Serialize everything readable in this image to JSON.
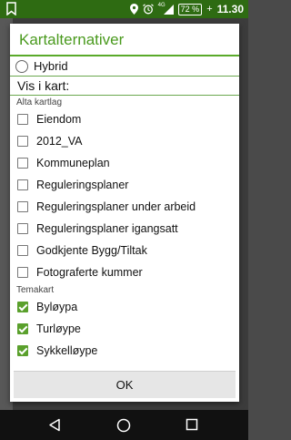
{
  "status_bar": {
    "network": "4G",
    "battery": "72 %",
    "time": "11.30"
  },
  "dialog": {
    "title": "Kartalternativer",
    "radio_option": "Hybrid",
    "vis_i_kart": "Vis i kart:",
    "alta_section": "Alta kartlag",
    "alta_layers": [
      {
        "label": "Eiendom",
        "checked": false
      },
      {
        "label": "2012_VA",
        "checked": false
      },
      {
        "label": "Kommuneplan",
        "checked": false
      },
      {
        "label": "Reguleringsplaner",
        "checked": false
      },
      {
        "label": "Reguleringsplaner under arbeid",
        "checked": false
      },
      {
        "label": "Reguleringsplaner igangsatt",
        "checked": false
      },
      {
        "label": "Godkjente Bygg/Tiltak",
        "checked": false
      },
      {
        "label": "Fotograferte kummer",
        "checked": false
      }
    ],
    "tema_section": "Temakart",
    "tema_layers": [
      {
        "label": "Byløypa",
        "checked": true
      },
      {
        "label": "Turløype",
        "checked": true
      },
      {
        "label": "Sykkelløype",
        "checked": true
      }
    ],
    "ok_label": "OK"
  },
  "colors": {
    "accent": "#4a9a1e",
    "status_bar": "#2e6b12",
    "checkbox_checked": "#5aa02c"
  },
  "icons": {
    "status_left": "map-app-icon",
    "status_right": [
      "location-icon",
      "alarm-icon",
      "signal-icon",
      "battery-icon"
    ],
    "nav": [
      "back-icon",
      "home-icon",
      "recents-icon"
    ]
  }
}
